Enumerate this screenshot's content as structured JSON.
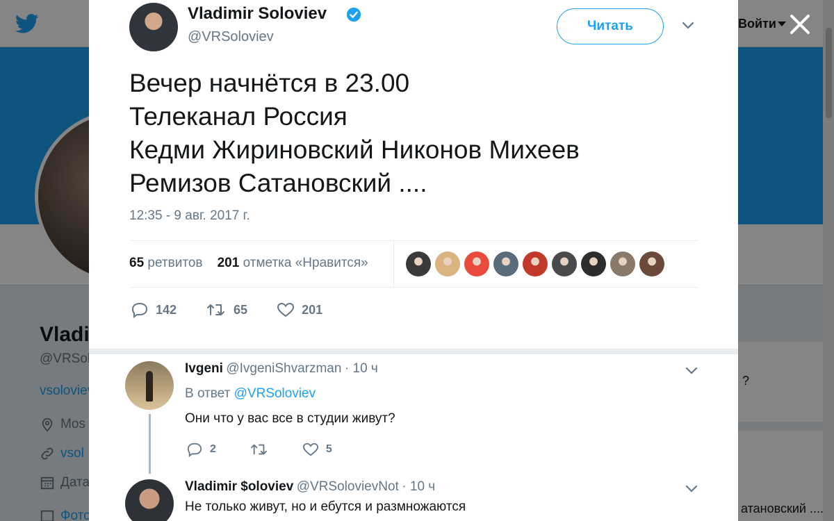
{
  "background": {
    "login_label": "Войти",
    "profile_name": "Vladi",
    "profile_handle": "@VRSol",
    "profile_link": "vsoloviev",
    "location": "Mos",
    "website": "vsol",
    "joined": "Дата",
    "photos": "Фото",
    "right_panel_q": "?",
    "right_panel_text": "атановский ...."
  },
  "tweet": {
    "author_name": "Vladimir Soloviev",
    "author_handle": "@VRSoloviev",
    "follow_label": "Читать",
    "text": "Вечер начнётся в 23.00\nТелеканал Россия\nКедми Жириновский Никонов Михеев\nРемизов Сатановский ....",
    "timestamp": "12:35 - 9 авг. 2017 г.",
    "retweets_count": "65",
    "retweets_label": "ретвитов",
    "likes_count": "201",
    "likes_label": "отметка «Нравится»",
    "reply_count": "142",
    "retweet_count": "65",
    "like_count": "201",
    "likers": [
      "#3a3a3a",
      "#d9b380",
      "#e84b3c",
      "#5a6b7c",
      "#c0392b",
      "#4a4a4a",
      "#2d2d2d",
      "#8a7a6a",
      "#6b4a3a"
    ]
  },
  "replies": [
    {
      "name": "Ivgeni",
      "handle": "@IvgeniShvarzman",
      "time": "· 10 ч",
      "in_reply_prefix": "В ответ",
      "in_reply_to": "@VRSoloviev",
      "text": "Они что у вас все в студии живут?",
      "reply_count": "2",
      "like_count": "5"
    },
    {
      "name": "Vladimir $oloviev",
      "handle": "@VRSolovievNot",
      "time": "· 10 ч",
      "text": "Не только живут, но и ебутся и размножаются"
    }
  ],
  "colors": {
    "accent": "#1da1f2",
    "muted": "#657786",
    "text": "#14171a"
  }
}
